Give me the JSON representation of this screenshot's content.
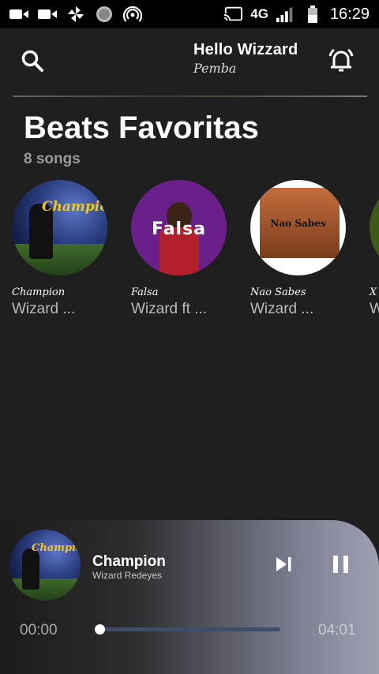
{
  "status_bar": {
    "network": "4G",
    "time": "16:29",
    "icons": [
      "video-icon",
      "video-icon",
      "pinwheel-icon",
      "circle-icon",
      "hotspot-icon",
      "cast-icon",
      "signal-icon",
      "battery-icon"
    ]
  },
  "header": {
    "greeting": "Hello Wizzard",
    "username": "Pemba",
    "search_icon": "search-icon",
    "notification_icon": "bell-icon"
  },
  "playlist": {
    "title": "Beats Favoritas",
    "count": "8 songs",
    "songs": [
      {
        "name": "Champion",
        "artist": "Wizard ...",
        "cover_text": "Champion"
      },
      {
        "name": "Falsa",
        "artist": "Wizard ft ...",
        "cover_text": "Falsa"
      },
      {
        "name": "Nao Sabes",
        "artist": "Wizard ...",
        "cover_text": "Nao Sabes"
      },
      {
        "name": "X",
        "artist": "W",
        "cover_text": ""
      }
    ]
  },
  "player": {
    "title": "Champion",
    "artist": "Wizard Redeyes",
    "current_time": "00:00",
    "total_time": "04:01",
    "progress": 0.0,
    "next_icon": "skip-next-icon",
    "pause_icon": "pause-icon"
  },
  "colors": {
    "background": "#1f1f1f",
    "status_bar": "#000000",
    "progress_track": "#3e4e6a"
  }
}
